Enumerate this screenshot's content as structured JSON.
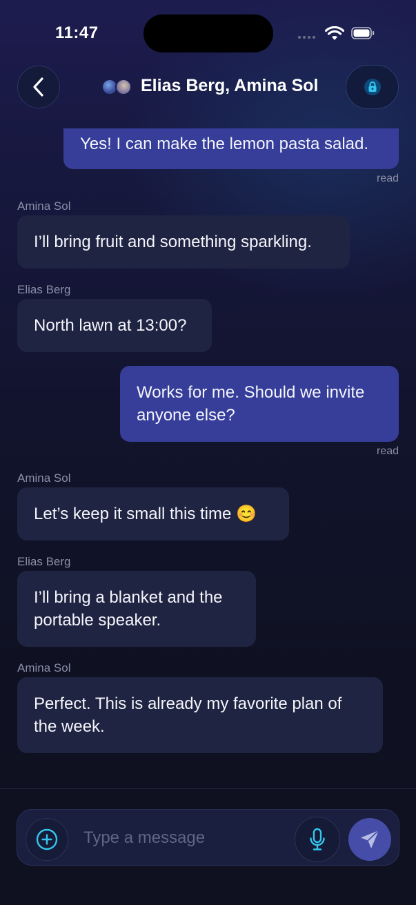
{
  "status_bar": {
    "time": "11:47"
  },
  "header": {
    "title": "Elias Berg, Amina Sol"
  },
  "messages": [
    {
      "from": "me",
      "text": "Yes! I can make the lemon pasta salad.",
      "receipt": "read"
    },
    {
      "from": "Amina Sol",
      "text": "I’ll bring fruit and something sparkling."
    },
    {
      "from": "Elias Berg",
      "text": "North lawn at 13:00?"
    },
    {
      "from": "me",
      "text": "Works for me. Should we invite anyone else?",
      "receipt": "read"
    },
    {
      "from": "Amina Sol",
      "text": "Let’s keep it small this time 😊"
    },
    {
      "from": "Elias Berg",
      "text": "I’ll bring a blanket and the portable speaker."
    },
    {
      "from": "Amina Sol",
      "text": "Perfect. This is already my favorite plan of the week."
    }
  ],
  "composer": {
    "placeholder": "Type a message"
  },
  "icons": {
    "back": "chevron-left-icon",
    "lock": "lock-icon",
    "add": "plus-circle-icon",
    "mic": "microphone-icon",
    "send": "paper-plane-icon"
  },
  "colors": {
    "accent": "#35c6f0",
    "outgoing_bubble": "#363e9a",
    "incoming_bubble": "#1f2442"
  }
}
